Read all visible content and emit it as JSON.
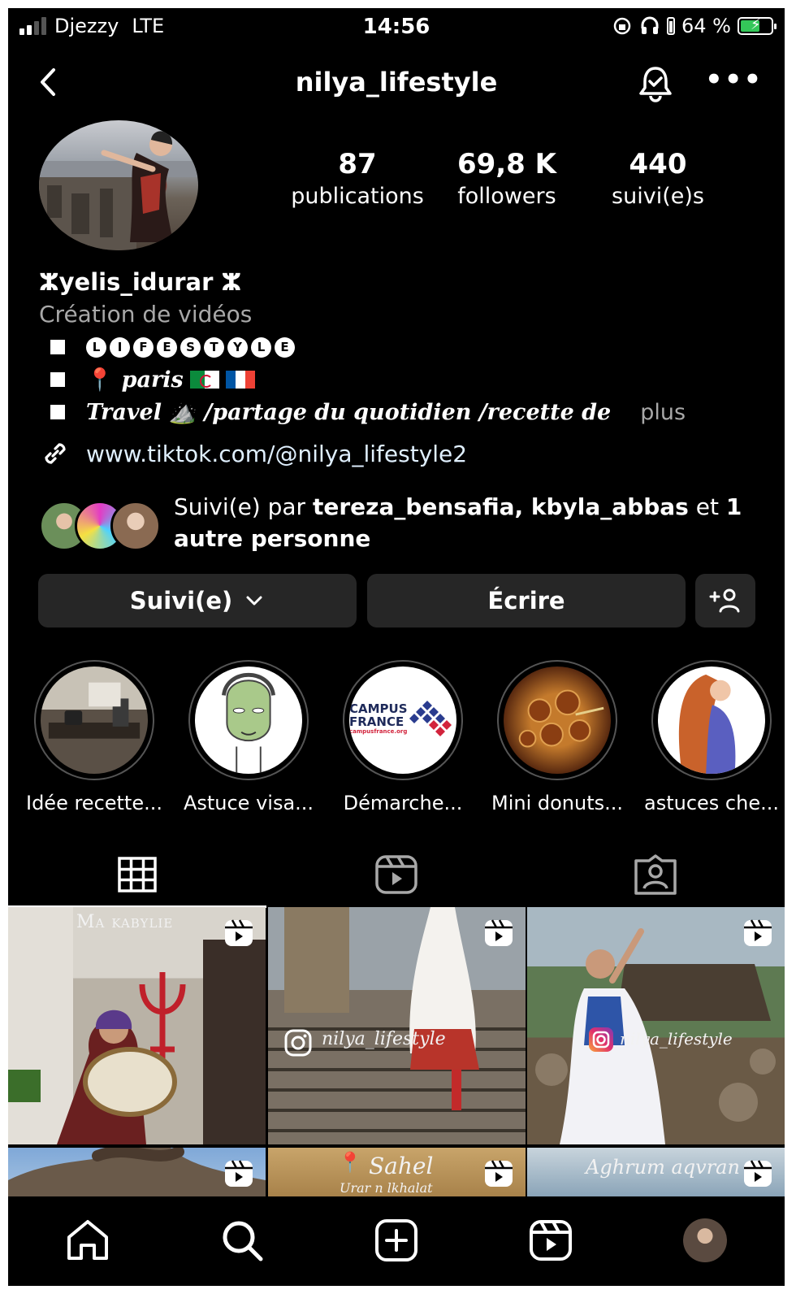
{
  "status": {
    "carrier": "Djezzy",
    "network": "LTE",
    "time": "14:56",
    "battery": "64 %",
    "battery_level": 0.64
  },
  "header": {
    "username": "nilya_lifestyle"
  },
  "stats": [
    {
      "value": "87",
      "label": "publications"
    },
    {
      "value": "69,8 K",
      "label": "followers"
    },
    {
      "value": "440",
      "label": "suivi(e)s"
    }
  ],
  "bio": {
    "name": "ⵣyelis_idurar ⵣ",
    "category": "Création de vidéos",
    "bubble_letters": [
      "L",
      "I",
      "F",
      "E",
      "S",
      "T",
      "Y",
      "L",
      "E"
    ],
    "line2": "paris",
    "line3": "Travel ⛰️ /partage du quotidien /recette de",
    "more": "plus",
    "link": "www.tiktok.com/@nilya_lifestyle2"
  },
  "followed_by": {
    "prefix": "Suivi(e) par ",
    "names": "tereza_bensafia, kbyla_abbas",
    "middle": " et ",
    "suffix": "1 autre personne"
  },
  "buttons": {
    "following": "Suivi(e)",
    "message": "Écrire"
  },
  "highlights": [
    {
      "label": "Idée recette..."
    },
    {
      "label": "Astuce  visa..."
    },
    {
      "label": "Démarche..."
    },
    {
      "label": "Mini donuts..."
    },
    {
      "label": "astuces che..."
    }
  ],
  "campus": {
    "line1": "CAMPUS",
    "line2": "FRANCE",
    "line3": "campusfrance.org"
  },
  "posts": [
    {
      "overlay": "Ma kabylie"
    },
    {
      "overlay": "nilya_lifestyle"
    },
    {
      "overlay": "nilya_lifestyle"
    },
    {
      "overlay": ""
    },
    {
      "overlay": "Sahel",
      "sub": "Urar n lkhalat"
    },
    {
      "overlay": "Aghrum aqvran"
    }
  ],
  "icons": [
    "back-icon",
    "notification-bell-icon",
    "more-icon",
    "link-icon",
    "chevron-down-icon",
    "add-person-icon",
    "grid-icon",
    "reels-icon",
    "tagged-icon",
    "home-icon",
    "search-icon",
    "create-icon",
    "profile-avatar"
  ]
}
